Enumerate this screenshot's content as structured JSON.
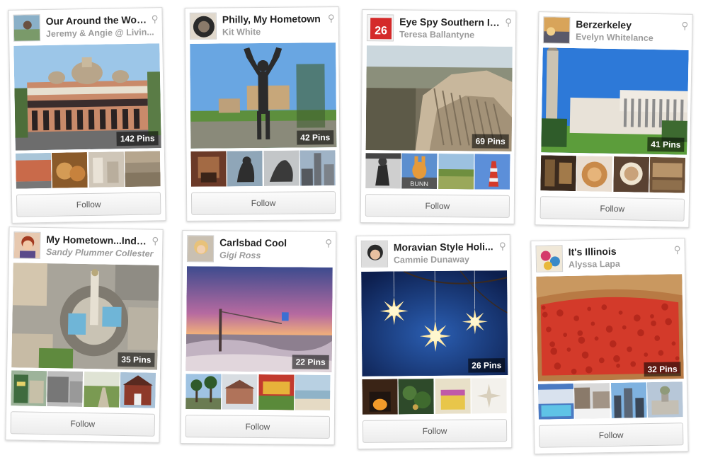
{
  "boards": [
    {
      "title": "Our Around the Wor...",
      "owner": "Jeremy & Angie @ Livin...",
      "pins": "142 Pins",
      "follow": "Follow",
      "owner_italic": false,
      "cover": "monastery",
      "thumbs": [
        "street",
        "bakery",
        "stacks",
        "aerial-city"
      ]
    },
    {
      "title": "Philly, My Hometown",
      "owner": "Kit White",
      "pins": "42 Pins",
      "follow": "Follow",
      "owner_italic": false,
      "cover": "rocky-statue",
      "thumbs": [
        "brick-room",
        "thinker",
        "sculpture",
        "city-tower"
      ]
    },
    {
      "title": "Eye Spy Southern Illi...",
      "owner": "Teresa Ballantyne",
      "pins": "69 Pins",
      "follow": "Follow",
      "owner_italic": false,
      "cover": "bluffs",
      "thumbs": [
        "boxer",
        "bunny-sign",
        "field",
        "lighthouse"
      ]
    },
    {
      "title": "Berzerkeley",
      "owner": "Evelyn Whitelance",
      "pins": "41 Pins",
      "follow": "Follow",
      "owner_italic": false,
      "cover": "campanile",
      "thumbs": [
        "interior",
        "pastry",
        "latte",
        "shop"
      ]
    },
    {
      "title": "My Hometown...India...",
      "owner": "Sandy Plummer Collester",
      "pins": "35 Pins",
      "follow": "Follow",
      "owner_italic": true,
      "cover": "monument-circle",
      "thumbs": [
        "storefront",
        "bw-street",
        "park-path",
        "red-house"
      ]
    },
    {
      "title": "Carlsbad Cool",
      "owner": "Gigi Ross",
      "pins": "22 Pins",
      "follow": "Follow",
      "owner_italic": true,
      "cover": "sunset-beach",
      "thumbs": [
        "palms",
        "train-station",
        "flower-sign",
        "shore"
      ]
    },
    {
      "title": "Moravian Style Holi...",
      "owner": "Cammie Dunaway",
      "pins": "26 Pins",
      "follow": "Follow",
      "owner_italic": false,
      "cover": "star-lanterns",
      "thumbs": [
        "fireplace",
        "greens",
        "cake",
        "star-ornament"
      ]
    },
    {
      "title": "It's Illinois",
      "owner": "Alyssa Lapa",
      "pins": "32 Pins",
      "follow": "Follow",
      "owner_italic": false,
      "cover": "deep-dish",
      "thumbs": [
        "pool",
        "street-snow",
        "skyline",
        "capitol"
      ]
    }
  ],
  "colors": {
    "pin_count_bg": "#000000",
    "follow_text": "#555555",
    "owner_text": "#9b9b9b"
  }
}
